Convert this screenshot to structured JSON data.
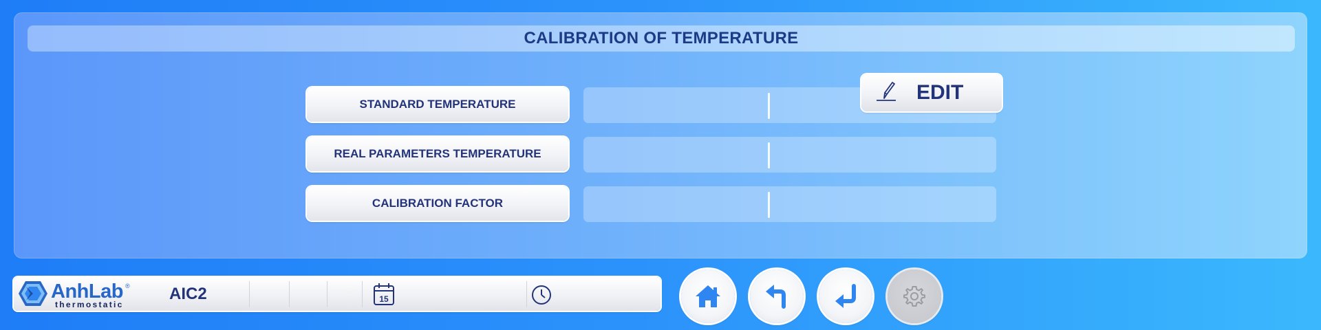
{
  "header": {
    "title": "CALIBRATION OF TEMPERATURE"
  },
  "rows": [
    {
      "label": "STANDARD TEMPERATURE",
      "value": "",
      "unit": ""
    },
    {
      "label": "REAL PARAMETERS TEMPERATURE",
      "value": "",
      "unit": ""
    },
    {
      "label": "CALIBRATION FACTOR",
      "value": "",
      "unit": ""
    }
  ],
  "edit": {
    "label": "EDIT",
    "icon": "pencil-icon"
  },
  "status": {
    "brand": "AnhLab",
    "brand_mark": "®",
    "brand_sub": "thermostatic",
    "device": "AIC2",
    "date": "",
    "time": "",
    "calendar_icon": "calendar-icon",
    "calendar_day": "15",
    "clock_icon": "clock-icon"
  },
  "nav": [
    {
      "name": "home",
      "icon": "home-icon",
      "enabled": true
    },
    {
      "name": "back",
      "icon": "back-arrow-icon",
      "enabled": true
    },
    {
      "name": "enter",
      "icon": "enter-arrow-icon",
      "enabled": true
    },
    {
      "name": "settings",
      "icon": "gear-icon",
      "enabled": false
    }
  ],
  "colors": {
    "accent": "#2767c7",
    "text_dark": "#23337a",
    "icon_blue": "#2f86f0"
  }
}
